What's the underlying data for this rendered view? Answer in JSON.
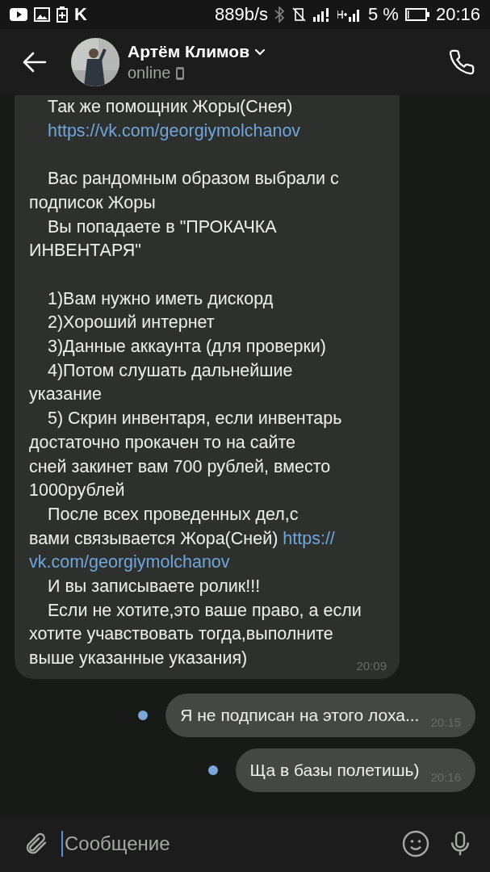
{
  "status_bar": {
    "app_letter": "K",
    "speed": "889b/s",
    "battery": "5 %",
    "time": "20:16"
  },
  "header": {
    "name": "Артём Климов",
    "status": "online"
  },
  "incoming": {
    "time": "20:09",
    "lines": [
      {
        "kind": "line",
        "indent": true,
        "parts": [
          {
            "kind": "text",
            "text": "Так же помощник Жоры(Снея)"
          }
        ]
      },
      {
        "kind": "line",
        "indent": true,
        "parts": [
          {
            "kind": "link",
            "text": "https://vk.com/georgiymolchanov"
          }
        ]
      },
      {
        "kind": "gap"
      },
      {
        "kind": "line",
        "indent": true,
        "parts": [
          {
            "kind": "text",
            "text": "Вас рандомным образом выбрали с"
          }
        ]
      },
      {
        "kind": "line",
        "indent": false,
        "parts": [
          {
            "kind": "text",
            "text": "подписок Жоры"
          }
        ]
      },
      {
        "kind": "line",
        "indent": true,
        "parts": [
          {
            "kind": "text",
            "text": "Вы попадаете в \"ПРОКАЧКА"
          }
        ]
      },
      {
        "kind": "line",
        "indent": false,
        "parts": [
          {
            "kind": "text",
            "text": "ИНВЕНТАРЯ\""
          }
        ]
      },
      {
        "kind": "gap"
      },
      {
        "kind": "line",
        "indent": true,
        "parts": [
          {
            "kind": "text",
            "text": "1)Вам нужно иметь дискорд"
          }
        ]
      },
      {
        "kind": "line",
        "indent": true,
        "parts": [
          {
            "kind": "text",
            "text": "2)Хороший интернет"
          }
        ]
      },
      {
        "kind": "line",
        "indent": true,
        "parts": [
          {
            "kind": "text",
            "text": "3)Данные аккаунта (для проверки)"
          }
        ]
      },
      {
        "kind": "line",
        "indent": true,
        "parts": [
          {
            "kind": "text",
            "text": "4)Потом слушать дальнейшие"
          }
        ]
      },
      {
        "kind": "line",
        "indent": false,
        "parts": [
          {
            "kind": "text",
            "text": "указание"
          }
        ]
      },
      {
        "kind": "line",
        "indent": true,
        "parts": [
          {
            "kind": "text",
            "text": "5) Скрин инвентаря, если инвентарь"
          }
        ]
      },
      {
        "kind": "line",
        "indent": false,
        "parts": [
          {
            "kind": "text",
            "text": "достаточно прокачен то на сайте"
          }
        ]
      },
      {
        "kind": "line",
        "indent": false,
        "parts": [
          {
            "kind": "text",
            "text": "сней закинет вам 700 рублей, вместо"
          }
        ]
      },
      {
        "kind": "line",
        "indent": false,
        "parts": [
          {
            "kind": "text",
            "text": "1000рублей"
          }
        ]
      },
      {
        "kind": "line",
        "indent": true,
        "parts": [
          {
            "kind": "text",
            "text": "После всех проведенных дел,с"
          }
        ]
      },
      {
        "kind": "line",
        "indent": false,
        "parts": [
          {
            "kind": "text",
            "text": "вами связывается Жора(Сней)"
          },
          {
            "kind": "link",
            "text": "https://"
          }
        ]
      },
      {
        "kind": "line",
        "indent": false,
        "parts": [
          {
            "kind": "link",
            "text": "vk.com/georgiymolchanov"
          }
        ]
      },
      {
        "kind": "line",
        "indent": true,
        "parts": [
          {
            "kind": "text",
            "text": "И вы записываете ролик!!!"
          }
        ]
      },
      {
        "kind": "line",
        "indent": true,
        "parts": [
          {
            "kind": "text",
            "text": "Если не хотите,это ваше право, а если"
          }
        ]
      },
      {
        "kind": "line",
        "indent": false,
        "parts": [
          {
            "kind": "text",
            "text": "хотите учавствовать тогда,выполните"
          }
        ]
      },
      {
        "kind": "line",
        "indent": false,
        "parts": [
          {
            "kind": "text",
            "text": "выше указанные указания)"
          }
        ]
      }
    ]
  },
  "outgoing": [
    {
      "text": "Я не подписан на этого лоха...",
      "time": "20:15",
      "unread": true
    },
    {
      "text": "Ща в базы полетишь)",
      "time": "20:16",
      "unread": true
    }
  ],
  "composer": {
    "placeholder": "Сообщение"
  }
}
